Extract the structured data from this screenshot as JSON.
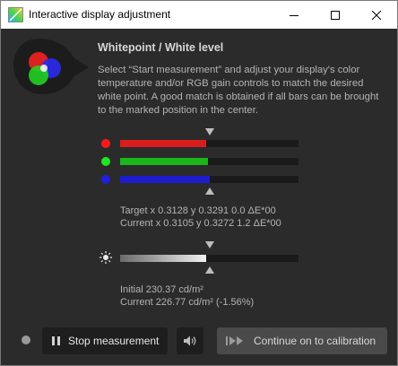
{
  "window": {
    "title": "Interactive display adjustment",
    "controls": {
      "minimize_icon": "minimize-icon",
      "maximize_icon": "maximize-icon",
      "close_icon": "close-icon"
    }
  },
  "header": {
    "title": "Whitepoint / White level",
    "description": "Select “Start measurement” and adjust your display's color temperature and/or RGB gain controls to match the desired white point. A good match is obtained if all bars can be brought to the marked position in the center."
  },
  "rgb_bars": [
    {
      "channel": "red",
      "color": "#d91d1d",
      "dot_color": "#ff1a1a",
      "level": 0.48
    },
    {
      "channel": "green",
      "color": "#1bb61b",
      "dot_color": "#22e522",
      "level": 0.49
    },
    {
      "channel": "blue",
      "color": "#1d1dcf",
      "dot_color": "#1f1fdd",
      "level": 0.5
    }
  ],
  "whitepoint": {
    "target": "Target x 0.3128 y 0.3291 0.0 ΔE*00",
    "current": "Current x 0.3105 y 0.3272 1.2 ΔE*00"
  },
  "white_level": {
    "icon": "sun-icon",
    "level": 0.48,
    "color": "#ebebeb",
    "initial": "Initial 230.37 cd/m²",
    "current": "Current 226.77 cd/m² (-1.56%)"
  },
  "footer": {
    "stop_label": "Stop measurement",
    "sound_icon": "speaker-icon",
    "continue_label": "Continue on to calibration"
  },
  "colors": {
    "background": "#2b2b2b",
    "track": "#1a1a1a",
    "text": "#b4b4b4"
  }
}
